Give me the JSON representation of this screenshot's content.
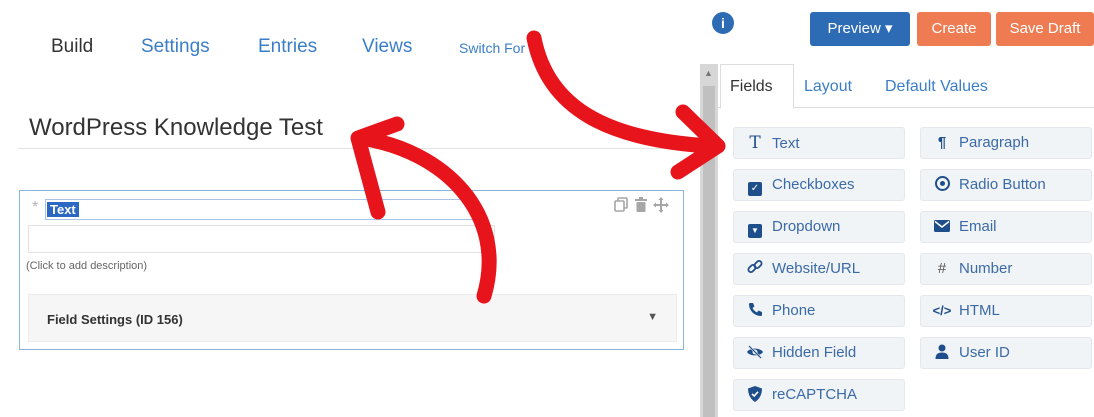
{
  "nav": {
    "build": "Build",
    "settings": "Settings",
    "entries": "Entries",
    "views": "Views",
    "switch_form": "Switch For"
  },
  "form": {
    "title": "WordPress Knowledge Test",
    "field": {
      "required_mark": "*",
      "label": "Text",
      "description": "(Click to add description)",
      "settings_label": "Field Settings (ID 156)"
    }
  },
  "toolbar": {
    "info": "i",
    "preview_label": "Preview ▾",
    "create_label": "Create",
    "save_draft_label": "Save Draft"
  },
  "tabs": {
    "fields": "Fields",
    "layout": "Layout",
    "default_values": "Default Values"
  },
  "field_types": [
    {
      "label": "Text",
      "icon": "text-icon"
    },
    {
      "label": "Paragraph",
      "icon": "paragraph-icon"
    },
    {
      "label": "Checkboxes",
      "icon": "checkbox-icon"
    },
    {
      "label": "Radio Button",
      "icon": "radio-icon"
    },
    {
      "label": "Dropdown",
      "icon": "dropdown-icon"
    },
    {
      "label": "Email",
      "icon": "envelope-icon"
    },
    {
      "label": "Website/URL",
      "icon": "link-icon"
    },
    {
      "label": "Number",
      "icon": "hash-icon"
    },
    {
      "label": "Phone",
      "icon": "phone-icon"
    },
    {
      "label": "HTML",
      "icon": "code-icon"
    },
    {
      "label": "Hidden Field",
      "icon": "eye-slash-icon"
    },
    {
      "label": "User ID",
      "icon": "user-icon"
    },
    {
      "label": "reCAPTCHA",
      "icon": "shield-icon"
    }
  ],
  "colors": {
    "primary": "#2d6bb5",
    "accent": "#ef7b52",
    "annotation": "#e8141b"
  }
}
